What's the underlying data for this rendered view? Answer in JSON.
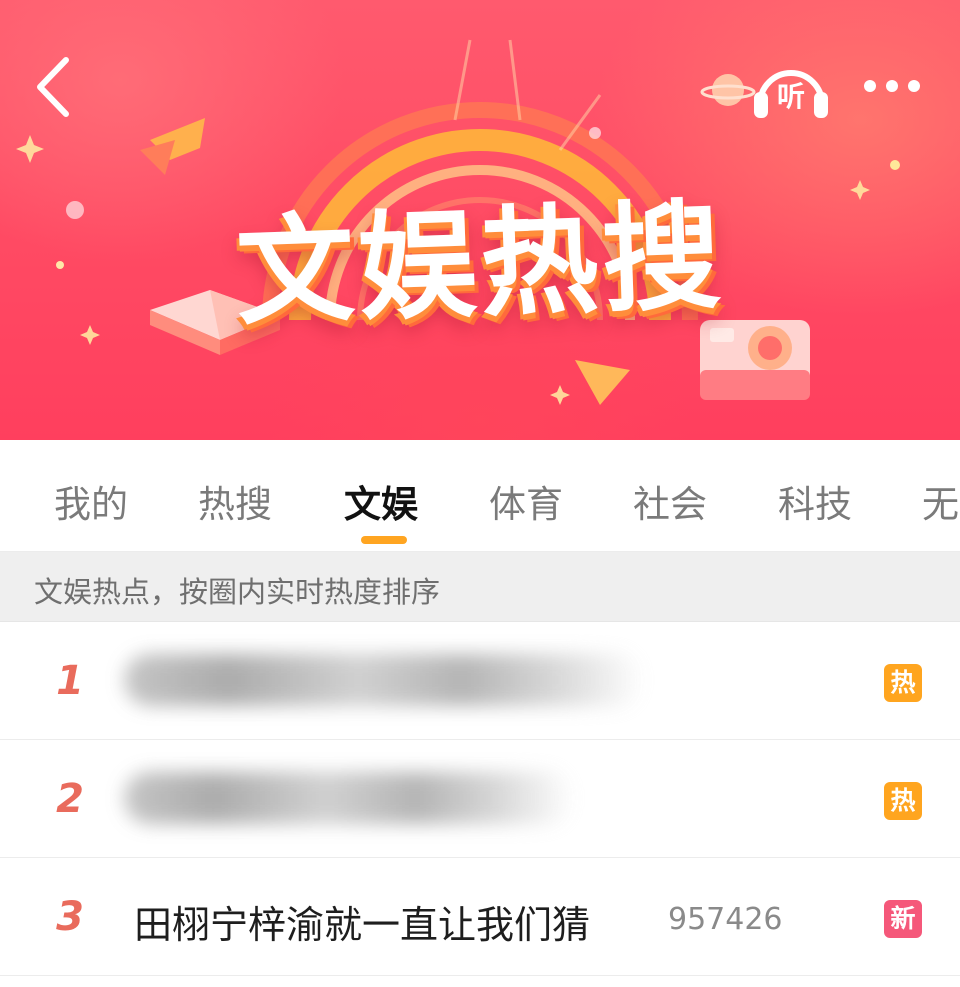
{
  "header": {
    "title": "文娱热搜",
    "back_icon": "chevron-left-icon",
    "listen_label": "听",
    "listen_icon": "headphones-icon",
    "more_icon": "more-dots-icon"
  },
  "tabs": [
    {
      "label": "我的",
      "active": false
    },
    {
      "label": "热搜",
      "active": false
    },
    {
      "label": "文娱",
      "active": true
    },
    {
      "label": "体育",
      "active": false
    },
    {
      "label": "社会",
      "active": false
    },
    {
      "label": "科技",
      "active": false
    },
    {
      "label": "无",
      "active": false
    }
  ],
  "hint": "文娱热点，按圈内实时热度排序",
  "list": [
    {
      "rank": "1",
      "title": "",
      "count": "",
      "badge": "热",
      "badge_type": "hot"
    },
    {
      "rank": "2",
      "title": "",
      "count": "",
      "badge": "热",
      "badge_type": "hot"
    },
    {
      "rank": "3",
      "title": "田栩宁梓渝就一直让我们猜",
      "count": "957426",
      "badge": "新",
      "badge_type": "new"
    }
  ],
  "colors": {
    "accent_underline": "#ffa521",
    "rank_color": "#e96b5c",
    "badge_hot": "#ffa51f",
    "badge_new": "#f5587a",
    "banner_base": "#ff4a63"
  }
}
